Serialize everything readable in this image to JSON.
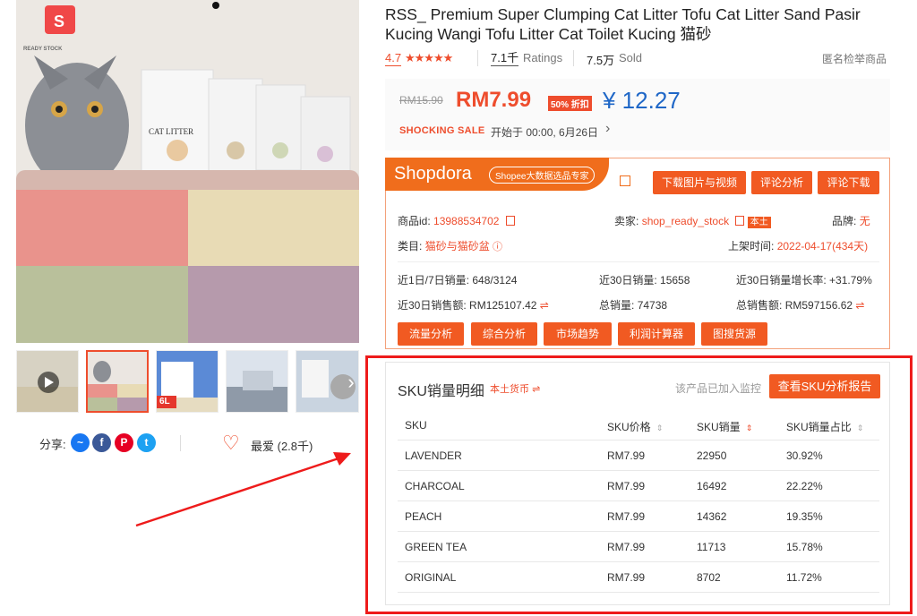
{
  "brand_badge": "READY STOCK",
  "product": {
    "title": "RSS_ Premium Super Clumping Cat Litter Tofu Cat Litter Sand Pasir Kucing Wangi Tofu Litter Cat Toilet Kucing 猫砂",
    "rating": "4.7",
    "stars": "★★★★★",
    "ratings_count": "7.1千",
    "ratings_label": "Ratings",
    "sold_count": "7.5万",
    "sold_label": "Sold",
    "report_link": "匿名检举商品"
  },
  "price": {
    "original": "RM15.90",
    "sale": "RM7.99",
    "discount": "50% 折扣",
    "cny": "¥ 12.27",
    "sale_label": "SHOCKING SALE",
    "sale_time": "开始于 00:00, 6月26日",
    "chevron": "›"
  },
  "images": {
    "packaging_label": "CAT LITTER",
    "thumb_tag": "6L"
  },
  "share": {
    "label": "分享:",
    "favorite": "最爱 (2.8千)"
  },
  "shopdora": {
    "logo": "Shopdora",
    "pill": "Shopee大数据选品专家",
    "buttons": [
      "下载图片与视频",
      "评论分析",
      "评论下载"
    ],
    "item_id_label": "商品id:",
    "item_id": "13988534702",
    "seller_label": "卖家:",
    "seller": "shop_ready_stock",
    "seller_badge": "本土",
    "brand_label": "品牌:",
    "brand": "无",
    "category_label": "类目:",
    "category": "猫砂与猫砂盆",
    "listed_label": "上架时间:",
    "listed": "2022-04-17(434天)",
    "stats": [
      {
        "label": "近1日/7日销量:",
        "value": "648/3124"
      },
      {
        "label": "近30日销量:",
        "value": "15658"
      },
      {
        "label": "近30日销量增长率:",
        "value": "+31.79%"
      },
      {
        "label": "近30日销售额:",
        "value": "RM125107.42"
      },
      {
        "label": "总销量:",
        "value": "74738"
      },
      {
        "label": "总销售额:",
        "value": "RM597156.62"
      }
    ],
    "tools": [
      "流量分析",
      "综合分析",
      "市场趋势",
      "利润计算器",
      "图搜货源"
    ]
  },
  "sku": {
    "title": "SKU销量明细",
    "currency_toggle": "本土货币",
    "monitor_note": "该产品已加入监控",
    "report_button": "查看SKU分析报告",
    "columns": [
      "SKU",
      "SKU价格",
      "SKU销量",
      "SKU销量占比"
    ],
    "rows": [
      [
        "LAVENDER",
        "RM7.99",
        "22950",
        "30.92%"
      ],
      [
        "CHARCOAL",
        "RM7.99",
        "16492",
        "22.22%"
      ],
      [
        "PEACH",
        "RM7.99",
        "14362",
        "19.35%"
      ],
      [
        "GREEN TEA",
        "RM7.99",
        "11713",
        "15.78%"
      ],
      [
        "ORIGINAL",
        "RM7.99",
        "8702",
        "11.72%"
      ]
    ]
  },
  "colors": {
    "accent": "#ee4d2d",
    "shopdora_orange": "#f15a22",
    "cny_blue": "#1f67c7",
    "highlight_red": "#ee1b1b"
  }
}
